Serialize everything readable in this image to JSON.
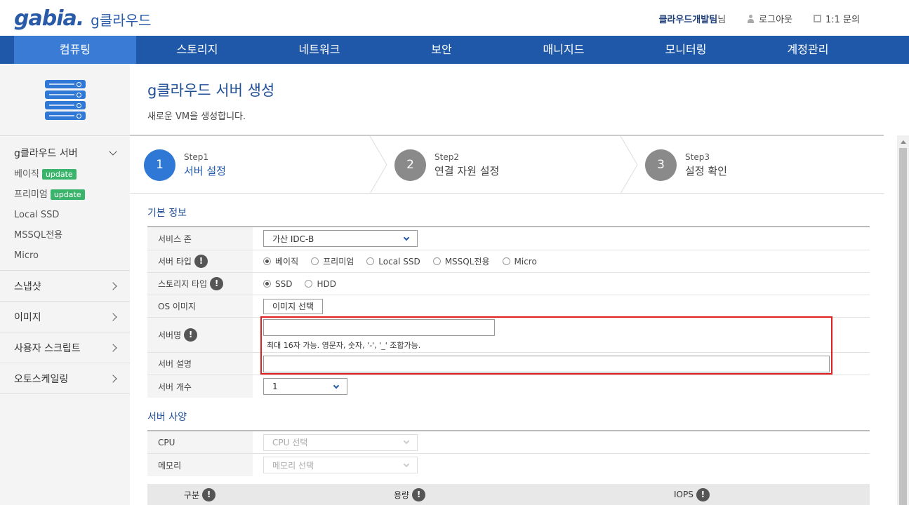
{
  "header": {
    "logo": "gabia.",
    "product": "g클라우드",
    "team_name": "클라우드개발팀",
    "team_suffix": "님",
    "logout": "로그아웃",
    "inquiry": "1:1 문의"
  },
  "nav": {
    "items": [
      "컴퓨팅",
      "스토리지",
      "네트워크",
      "보안",
      "매니지드",
      "모니터링",
      "계정관리"
    ],
    "active": "컴퓨팅"
  },
  "sidebar": {
    "groups": [
      {
        "label": "g클라우드 서버",
        "open": true,
        "items": [
          {
            "label": "베이직",
            "badge": "update"
          },
          {
            "label": "프리미엄",
            "badge": "update"
          },
          {
            "label": "Local SSD"
          },
          {
            "label": "MSSQL전용"
          },
          {
            "label": "Micro"
          }
        ]
      },
      {
        "label": "스냅샷"
      },
      {
        "label": "이미지"
      },
      {
        "label": "사용자 스크립트"
      },
      {
        "label": "오토스케일링"
      }
    ]
  },
  "page": {
    "title": "g클라우드 서버 생성",
    "description": "새로운 VM을 생성합니다."
  },
  "steps": [
    {
      "num": "1",
      "step": "Step1",
      "name": "서버 설정",
      "active": true
    },
    {
      "num": "2",
      "step": "Step2",
      "name": "연결 자원 설정",
      "active": false
    },
    {
      "num": "3",
      "step": "Step3",
      "name": "설정 확인",
      "active": false
    }
  ],
  "basic": {
    "title": "기본 정보",
    "zone_label": "서비스 존",
    "zone_value": "가산 IDC-B",
    "type_label": "서버 타입",
    "type_options": [
      "베이직",
      "프리미엄",
      "Local SSD",
      "MSSQL전용",
      "Micro"
    ],
    "type_selected": "베이직",
    "storage_label": "스토리지 타입",
    "storage_options": [
      "SSD",
      "HDD"
    ],
    "storage_selected": "SSD",
    "os_label": "OS 이미지",
    "os_button": "이미지 선택",
    "name_label": "서버명",
    "name_value": "",
    "name_hint": "최대 16자 가능. 영문자, 숫자, '-', '_' 조합가능.",
    "desc_label": "서버 설명",
    "desc_value": "",
    "count_label": "서버 개수",
    "count_value": "1"
  },
  "spec": {
    "title": "서버 사양",
    "cpu_label": "CPU",
    "cpu_placeholder": "CPU 선택",
    "mem_label": "메모리",
    "mem_placeholder": "메모리 선택",
    "table_headers": [
      "구분",
      "용량",
      "IOPS"
    ]
  },
  "colors": {
    "nav_bg": "#1f58a8",
    "nav_active": "#3a7bd5",
    "accent": "#2f78d6",
    "badge": "#3bb46b",
    "highlight": "#e02020"
  }
}
